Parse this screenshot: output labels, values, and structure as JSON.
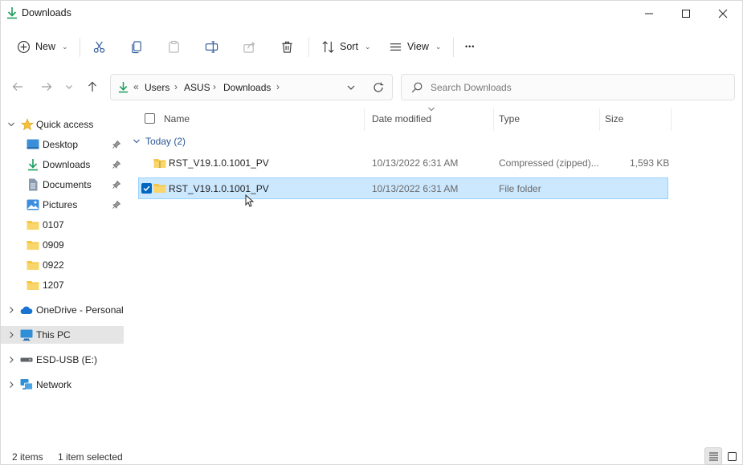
{
  "window": {
    "title": "Downloads",
    "controls": {
      "minimize": "minimize",
      "maximize": "maximize",
      "close": "close"
    }
  },
  "toolbar": {
    "new_label": "New",
    "sort_label": "Sort",
    "view_label": "View",
    "more_label": "•••"
  },
  "address": {
    "overflow": "«",
    "crumbs": [
      "Users",
      "ASUS",
      "Downloads"
    ],
    "separator": "›"
  },
  "search": {
    "placeholder": "Search Downloads"
  },
  "nav": {
    "quick_access": "Quick access",
    "pinned": [
      "Desktop",
      "Downloads",
      "Documents",
      "Pictures"
    ],
    "folders": [
      "0107",
      "0909",
      "0922",
      "1207"
    ],
    "onedrive": "OneDrive - Personal",
    "this_pc": "This PC",
    "usb": "ESD-USB (E:)",
    "network": "Network"
  },
  "columns": {
    "name": "Name",
    "date": "Date modified",
    "type": "Type",
    "size": "Size"
  },
  "group": {
    "label": "Today (2)"
  },
  "files": [
    {
      "name": "RST_V19.1.0.1001_PV",
      "date": "10/13/2022 6:31 AM",
      "type": "Compressed (zipped)...",
      "size": "1,593 KB",
      "selected": false
    },
    {
      "name": "RST_V19.1.0.1001_PV",
      "date": "10/13/2022 6:31 AM",
      "type": "File folder",
      "size": "",
      "selected": true
    }
  ],
  "status": {
    "count": "2 items",
    "selection": "1 item selected"
  },
  "colors": {
    "accent": "#0067c0",
    "selection": "#cce8ff",
    "folder": "#f4c542"
  }
}
